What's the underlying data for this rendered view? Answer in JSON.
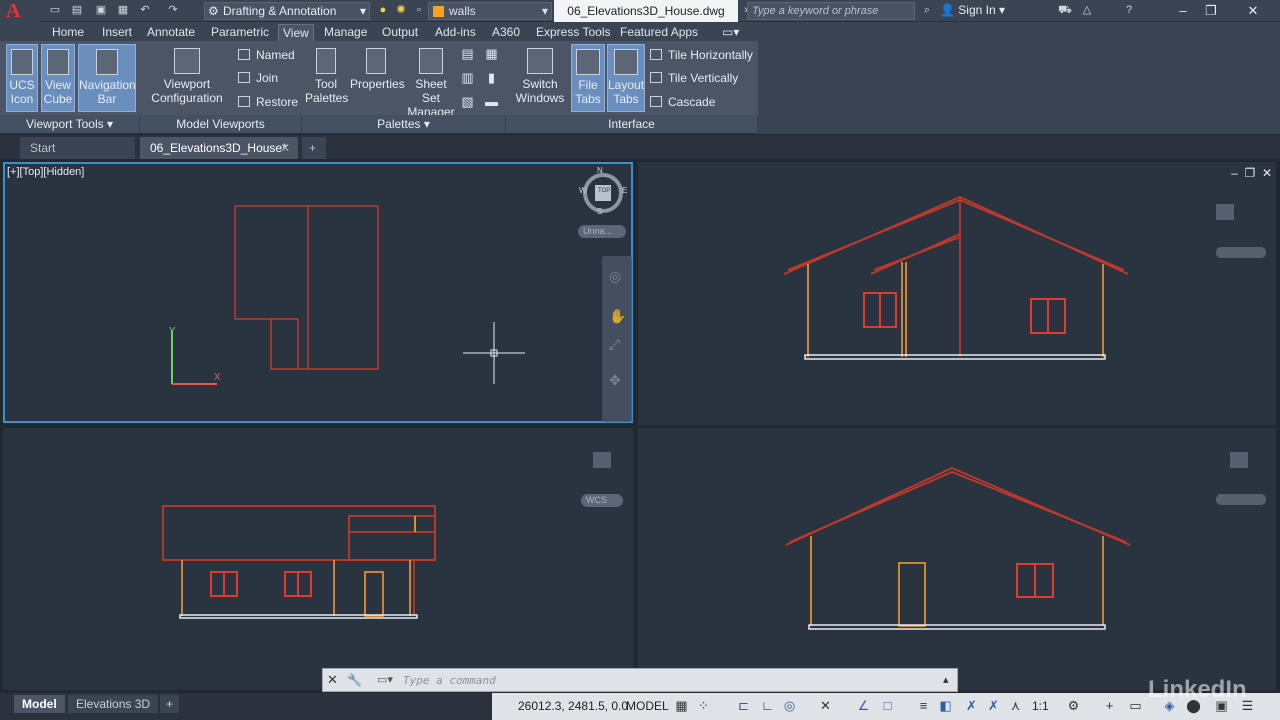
{
  "title_bar": {
    "app_letter": "A",
    "workspace": "Drafting & Annotation",
    "layer": "walls",
    "document_title": "06_Elevations3D_House.dwg",
    "search_placeholder": "Type a keyword or phrase",
    "sign_in": "Sign In"
  },
  "ribbon_tabs": [
    "Home",
    "Insert",
    "Annotate",
    "Parametric",
    "View",
    "Manage",
    "Output",
    "Add-ins",
    "A360",
    "Express Tools",
    "Featured Apps"
  ],
  "active_tab": "View",
  "ribbon": {
    "ucs_icon": "UCS Icon",
    "view_cube": "View Cube",
    "navigation_bar": "Navigation Bar",
    "viewport_configuration": "Viewport Configuration",
    "named": "Named",
    "join": "Join",
    "restore": "Restore",
    "tool_palettes": "Tool Palettes",
    "properties": "Properties",
    "sheet_set_manager": "Sheet Set Manager",
    "switch_windows": "Switch Windows",
    "file_tabs": "File Tabs",
    "layout_tabs": "Layout Tabs",
    "tile_horizontally": "Tile Horizontally",
    "tile_vertically": "Tile Vertically",
    "cascade": "Cascade",
    "panels": {
      "viewport_tools": "Viewport Tools",
      "model_viewports": "Model Viewports",
      "palettes": "Palettes",
      "interface": "Interface"
    }
  },
  "file_tabs": {
    "start": "Start",
    "active": "06_Elevations3D_House*"
  },
  "viewports": {
    "top_label": "[+][Top][Hidden]",
    "compass": {
      "n": "N",
      "s": "S",
      "e": "E",
      "w": "W",
      "cube": "TOP"
    },
    "ucs_pill": "Unna...",
    "wcs_pill": "WCS"
  },
  "command_line": {
    "placeholder": "Type a command"
  },
  "status_bar": {
    "layout_tabs": [
      "Model",
      "Elevations 3D"
    ],
    "coordinates": "26012.3, 2481.5, 0.0",
    "model": "MODEL",
    "scale": "1:1"
  },
  "watermark": "LinkedIn",
  "colors": {
    "drawing_red": "#c0392b",
    "window_red": "#e23a2e",
    "wall_orange": "#f29a2e",
    "viewport_bg": "#2a3340",
    "active_border": "#3a8fd0"
  }
}
